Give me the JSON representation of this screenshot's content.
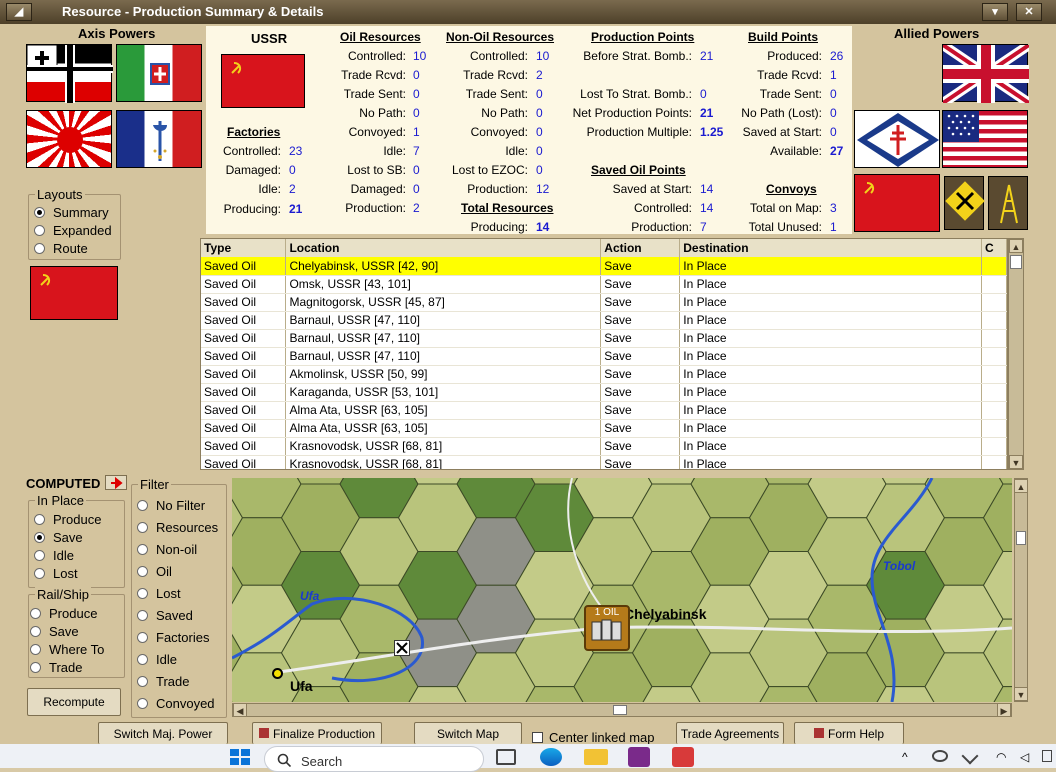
{
  "window": {
    "title": "Resource - Production Summary & Details",
    "left_btn": "◢",
    "minimize": "▾",
    "close": "✕"
  },
  "axis": {
    "title": "Axis Powers"
  },
  "allied": {
    "title": "Allied Powers"
  },
  "country": "USSR",
  "factories": {
    "title": "Factories",
    "controlled_l": "Controlled:",
    "controlled": "23",
    "damaged_l": "Damaged:",
    "damaged": "0",
    "idle_l": "Idle:",
    "idle": "2",
    "producing_l": "Producing:",
    "producing": "21"
  },
  "oil": {
    "title": "Oil Resources",
    "controlled_l": "Controlled:",
    "controlled": "10",
    "trade_rcvd_l": "Trade Rcvd:",
    "trade_rcvd": "0",
    "trade_sent_l": "Trade Sent:",
    "trade_sent": "0",
    "no_path_l": "No Path:",
    "no_path": "0",
    "convoyed_l": "Convoyed:",
    "convoyed": "1",
    "idle_l": "Idle:",
    "idle": "7",
    "lost_sb_l": "Lost to SB:",
    "lost_sb": "0",
    "damaged_l": "Damaged:",
    "damaged": "0",
    "production_l": "Production:",
    "production": "2"
  },
  "nonoil": {
    "title": "Non-Oil Resources",
    "controlled_l": "Controlled:",
    "controlled": "10",
    "trade_rcvd_l": "Trade Rcvd:",
    "trade_rcvd": "2",
    "trade_sent_l": "Trade Sent:",
    "trade_sent": "0",
    "no_path_l": "No Path:",
    "no_path": "0",
    "convoyed_l": "Convoyed:",
    "convoyed": "0",
    "idle_l": "Idle:",
    "idle": "0",
    "lost_ezoc_l": "Lost to EZOC:",
    "lost_ezoc": "0",
    "production_l": "Production:",
    "production": "12"
  },
  "total": {
    "title": "Total Resources",
    "producing_l": "Producing:",
    "producing": "14"
  },
  "pp": {
    "title": "Production Points",
    "before_l": "Before Strat. Bomb.:",
    "before": "21",
    "lost_l": "Lost To Strat. Bomb.:",
    "lost": "0",
    "net_l": "Net Production Points:",
    "net": "21",
    "mult_l": "Production Multiple:",
    "mult": "1.25"
  },
  "soil": {
    "title": "Saved Oil Points",
    "saved_l": "Saved at Start:",
    "saved": "14",
    "controlled_l": "Controlled:",
    "controlled": "14",
    "production_l": "Production:",
    "production": "7"
  },
  "bp": {
    "title": "Build Points",
    "produced_l": "Produced:",
    "produced": "26",
    "trade_rcvd_l": "Trade Rcvd:",
    "trade_rcvd": "1",
    "trade_sent_l": "Trade Sent:",
    "trade_sent": "0",
    "no_path_l": "No Path (Lost):",
    "no_path": "0",
    "saved_l": "Saved at Start:",
    "saved": "0",
    "avail_l": "Available:",
    "avail": "27"
  },
  "convoys": {
    "title": "Convoys",
    "total_map_l": "Total on Map:",
    "total_map": "3",
    "total_unused_l": "Total Unused:",
    "total_unused": "1"
  },
  "layouts": {
    "title": "Layouts",
    "options": [
      "Summary",
      "Expanded",
      "Route"
    ]
  },
  "table": {
    "headers": [
      "Type",
      "Location",
      "Action",
      "Destination",
      "C"
    ],
    "rows": [
      [
        "Saved Oil",
        "Chelyabinsk, USSR [42, 90]",
        "Save",
        "In Place"
      ],
      [
        "Saved Oil",
        "Omsk, USSR [43, 101]",
        "Save",
        "In Place"
      ],
      [
        "Saved Oil",
        "Magnitogorsk, USSR [45, 87]",
        "Save",
        "In Place"
      ],
      [
        "Saved Oil",
        "Barnaul, USSR [47, 110]",
        "Save",
        "In Place"
      ],
      [
        "Saved Oil",
        "Barnaul, USSR [47, 110]",
        "Save",
        "In Place"
      ],
      [
        "Saved Oil",
        "Barnaul, USSR [47, 110]",
        "Save",
        "In Place"
      ],
      [
        "Saved Oil",
        "Akmolinsk, USSR [50, 99]",
        "Save",
        "In Place"
      ],
      [
        "Saved Oil",
        "Karaganda, USSR [53, 101]",
        "Save",
        "In Place"
      ],
      [
        "Saved Oil",
        "Alma Ata, USSR [63, 105]",
        "Save",
        "In Place"
      ],
      [
        "Saved Oil",
        "Alma Ata, USSR [63, 105]",
        "Save",
        "In Place"
      ],
      [
        "Saved Oil",
        "Krasnovodsk, USSR [68, 81]",
        "Save",
        "In Place"
      ],
      [
        "Saved Oil",
        "Krasnovodsk, USSR [68, 81]",
        "Save",
        "In Place"
      ]
    ]
  },
  "computed": {
    "title": "COMPUTED"
  },
  "inplace": {
    "title": "In Place",
    "options": [
      "Produce",
      "Save",
      "Idle",
      "Lost"
    ]
  },
  "railship": {
    "title": "Rail/Ship",
    "options": [
      "Produce",
      "Save",
      "Where To",
      "Trade"
    ]
  },
  "filter": {
    "title": "Filter",
    "options": [
      "No Filter",
      "Resources",
      "Non-oil",
      "Oil",
      "Lost",
      "Saved",
      "Factories",
      "Idle",
      "Trade",
      "Convoyed"
    ]
  },
  "recompute": "Recompute",
  "map": {
    "ufa_river": "Ufa",
    "ufa_city": "Ufa",
    "tobol": "Tobol",
    "chelyabinsk": "Chelyabinsk",
    "counter": "1 OIL"
  },
  "bottom": {
    "switch": "Switch Maj. Power",
    "finalize": "Finalize Production",
    "switch_map": "Switch Map",
    "center": "Center linked map",
    "trade": "Trade Agreements",
    "help": "Form Help"
  },
  "taskbar": {
    "search": "Search"
  }
}
